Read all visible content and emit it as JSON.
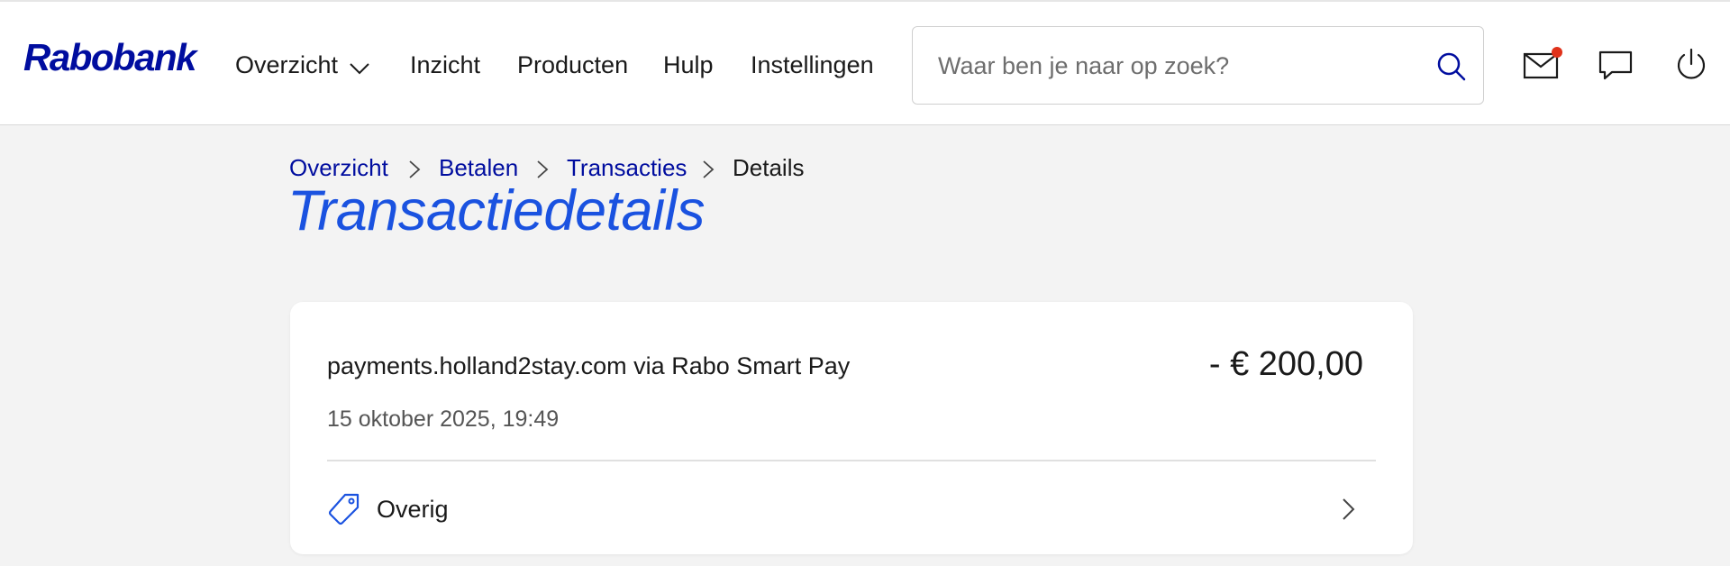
{
  "brand": {
    "logo_text": "Rabobank",
    "color": "#000d9f"
  },
  "nav": {
    "items": [
      {
        "label": "Overzicht",
        "has_dropdown": true
      },
      {
        "label": "Inzicht"
      },
      {
        "label": "Producten"
      },
      {
        "label": "Hulp"
      },
      {
        "label": "Instellingen"
      }
    ]
  },
  "search": {
    "placeholder": "Waar ben je naar op zoek?",
    "value": "",
    "icon": "search-icon"
  },
  "header_icons": [
    {
      "name": "mail-icon",
      "has_notification": true
    },
    {
      "name": "chat-icon"
    },
    {
      "name": "power-icon"
    }
  ],
  "breadcrumb": {
    "items": [
      {
        "label": "Overzicht"
      },
      {
        "label": "Betalen"
      },
      {
        "label": "Transacties"
      },
      {
        "label": "Details"
      }
    ]
  },
  "page": {
    "title": "Transactiedetails"
  },
  "transaction": {
    "merchant": "payments.holland2stay.com via Rabo Smart Pay",
    "amount": "- € 200,00",
    "datetime": "15 oktober 2025, 19:49",
    "category": {
      "label": "Overig",
      "icon": "tag-icon"
    }
  },
  "colors": {
    "accent": "#1a52e0",
    "link": "#000d9f",
    "notification": "#e0321b",
    "background": "#f3f3f3"
  }
}
